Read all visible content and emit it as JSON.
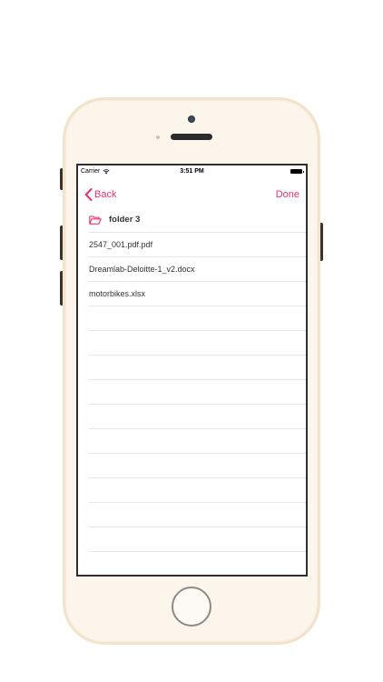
{
  "status_bar": {
    "carrier": "Carrier",
    "time": "3:51 PM"
  },
  "nav": {
    "back_label": "Back",
    "done_label": "Done",
    "accent_color": "#e8316e"
  },
  "folder": {
    "name": "folder 3",
    "icon": "folder-open-icon"
  },
  "files": [
    {
      "name": "2547_001.pdf.pdf"
    },
    {
      "name": "Dreamlab-Deloitte-1_v2.docx"
    },
    {
      "name": "motorbikes.xlsx"
    }
  ],
  "device": {
    "body_color": "#fbf5ec",
    "trim_color": "#f4e3cc"
  }
}
